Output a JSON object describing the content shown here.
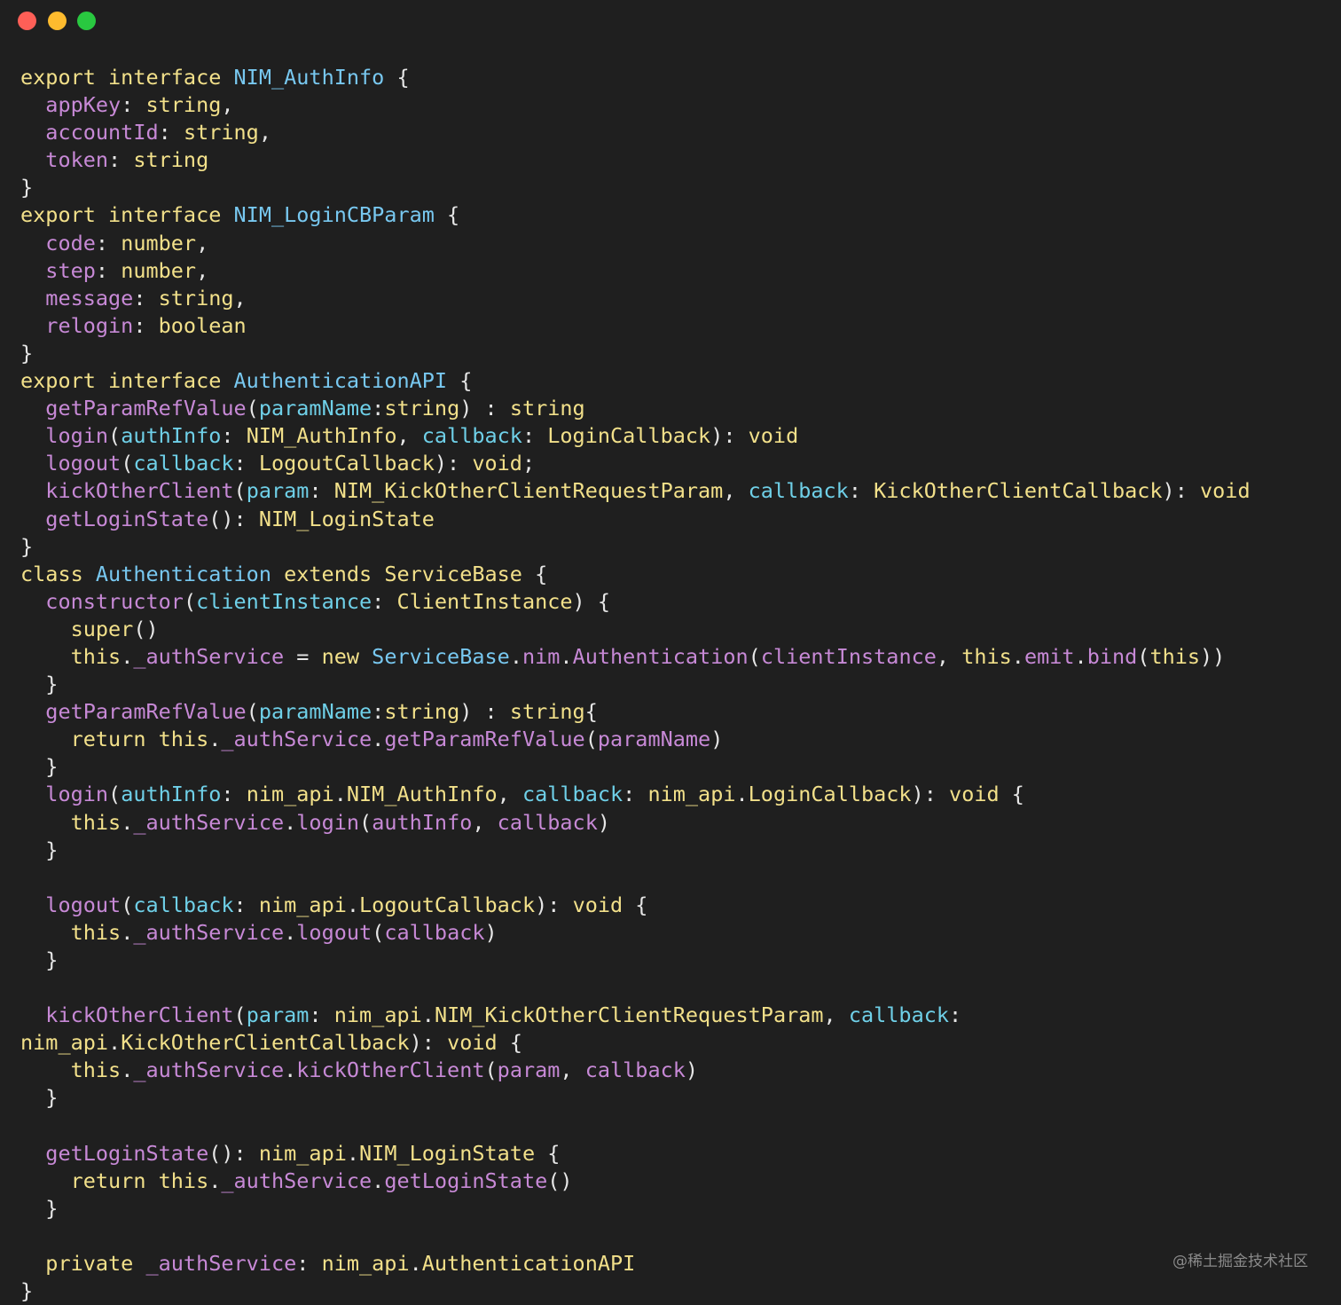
{
  "window": {
    "controls": [
      {
        "name": "close",
        "color": "#fe5f57"
      },
      {
        "name": "minimize",
        "color": "#febb2e"
      },
      {
        "name": "zoom",
        "color": "#29c840"
      }
    ]
  },
  "colors": {
    "background": "#1f1f1f",
    "keyword": "#f2e08a",
    "type": "#78c8f0",
    "property": "#c789d6",
    "parameter": "#6fd0e8",
    "plain": "#e6e6e6"
  },
  "code_lines": [
    [
      [
        "kw",
        "export interface "
      ],
      [
        "type",
        "NIM_AuthInfo"
      ],
      [
        "plain",
        " {"
      ]
    ],
    [
      [
        "plain",
        "  "
      ],
      [
        "prop",
        "appKey"
      ],
      [
        "plain",
        ": "
      ],
      [
        "kw",
        "string"
      ],
      [
        "plain",
        ","
      ]
    ],
    [
      [
        "plain",
        "  "
      ],
      [
        "prop",
        "accountId"
      ],
      [
        "plain",
        ": "
      ],
      [
        "kw",
        "string"
      ],
      [
        "plain",
        ","
      ]
    ],
    [
      [
        "plain",
        "  "
      ],
      [
        "prop",
        "token"
      ],
      [
        "plain",
        ": "
      ],
      [
        "kw",
        "string"
      ]
    ],
    [
      [
        "plain",
        "}"
      ]
    ],
    [
      [
        "kw",
        "export interface "
      ],
      [
        "type",
        "NIM_LoginCBParam"
      ],
      [
        "plain",
        " {"
      ]
    ],
    [
      [
        "plain",
        "  "
      ],
      [
        "prop",
        "code"
      ],
      [
        "plain",
        ": "
      ],
      [
        "kw",
        "number"
      ],
      [
        "plain",
        ","
      ]
    ],
    [
      [
        "plain",
        "  "
      ],
      [
        "prop",
        "step"
      ],
      [
        "plain",
        ": "
      ],
      [
        "kw",
        "number"
      ],
      [
        "plain",
        ","
      ]
    ],
    [
      [
        "plain",
        "  "
      ],
      [
        "prop",
        "message"
      ],
      [
        "plain",
        ": "
      ],
      [
        "kw",
        "string"
      ],
      [
        "plain",
        ","
      ]
    ],
    [
      [
        "plain",
        "  "
      ],
      [
        "prop",
        "relogin"
      ],
      [
        "plain",
        ": "
      ],
      [
        "kw",
        "boolean"
      ]
    ],
    [
      [
        "plain",
        "}"
      ]
    ],
    [
      [
        "kw",
        "export interface "
      ],
      [
        "type",
        "AuthenticationAPI"
      ],
      [
        "plain",
        " {"
      ]
    ],
    [
      [
        "plain",
        "  "
      ],
      [
        "fn",
        "getParamRefValue"
      ],
      [
        "plain",
        "("
      ],
      [
        "param",
        "paramName"
      ],
      [
        "plain",
        ":"
      ],
      [
        "kw",
        "string"
      ],
      [
        "plain",
        ") : "
      ],
      [
        "kw",
        "string"
      ]
    ],
    [
      [
        "plain",
        "  "
      ],
      [
        "fn",
        "login"
      ],
      [
        "plain",
        "("
      ],
      [
        "param",
        "authInfo"
      ],
      [
        "plain",
        ": "
      ],
      [
        "kw",
        "NIM_AuthInfo"
      ],
      [
        "plain",
        ", "
      ],
      [
        "param",
        "callback"
      ],
      [
        "plain",
        ": "
      ],
      [
        "kw",
        "LoginCallback"
      ],
      [
        "plain",
        "): "
      ],
      [
        "kw",
        "void"
      ]
    ],
    [
      [
        "plain",
        "  "
      ],
      [
        "fn",
        "logout"
      ],
      [
        "plain",
        "("
      ],
      [
        "param",
        "callback"
      ],
      [
        "plain",
        ": "
      ],
      [
        "kw",
        "LogoutCallback"
      ],
      [
        "plain",
        "): "
      ],
      [
        "kw",
        "void"
      ],
      [
        "plain",
        ";"
      ]
    ],
    [
      [
        "plain",
        "  "
      ],
      [
        "fn",
        "kickOtherClient"
      ],
      [
        "plain",
        "("
      ],
      [
        "param",
        "param"
      ],
      [
        "plain",
        ": "
      ],
      [
        "kw",
        "NIM_KickOtherClientRequestParam"
      ],
      [
        "plain",
        ", "
      ],
      [
        "param",
        "callback"
      ],
      [
        "plain",
        ": "
      ],
      [
        "kw",
        "KickOtherClientCallback"
      ],
      [
        "plain",
        "): "
      ],
      [
        "kw",
        "void"
      ]
    ],
    [
      [
        "plain",
        "  "
      ],
      [
        "fn",
        "getLoginState"
      ],
      [
        "plain",
        "(): "
      ],
      [
        "kw",
        "NIM_LoginState"
      ]
    ],
    [
      [
        "plain",
        "}"
      ]
    ],
    [
      [
        "kw",
        "class "
      ],
      [
        "type",
        "Authentication"
      ],
      [
        "kw",
        " extends "
      ],
      [
        "kw",
        "ServiceBase"
      ],
      [
        "plain",
        " {"
      ]
    ],
    [
      [
        "plain",
        "  "
      ],
      [
        "fn",
        "constructor"
      ],
      [
        "plain",
        "("
      ],
      [
        "param",
        "clientInstance"
      ],
      [
        "plain",
        ": "
      ],
      [
        "kw",
        "ClientInstance"
      ],
      [
        "plain",
        ") {"
      ]
    ],
    [
      [
        "plain",
        "    "
      ],
      [
        "kw",
        "super"
      ],
      [
        "plain",
        "()"
      ]
    ],
    [
      [
        "plain",
        "    "
      ],
      [
        "kw",
        "this"
      ],
      [
        "plain",
        "."
      ],
      [
        "fn",
        "_authService"
      ],
      [
        "plain",
        " = "
      ],
      [
        "kw",
        "new "
      ],
      [
        "type",
        "ServiceBase"
      ],
      [
        "plain",
        "."
      ],
      [
        "fn",
        "nim"
      ],
      [
        "plain",
        "."
      ],
      [
        "fn",
        "Authentication"
      ],
      [
        "plain",
        "("
      ],
      [
        "fn",
        "clientInstance"
      ],
      [
        "plain",
        ", "
      ],
      [
        "kw",
        "this"
      ],
      [
        "plain",
        "."
      ],
      [
        "fn",
        "emit"
      ],
      [
        "plain",
        "."
      ],
      [
        "fn",
        "bind"
      ],
      [
        "plain",
        "("
      ],
      [
        "kw",
        "this"
      ],
      [
        "plain",
        "))"
      ]
    ],
    [
      [
        "plain",
        "  }"
      ]
    ],
    [
      [
        "plain",
        "  "
      ],
      [
        "fn",
        "getParamRefValue"
      ],
      [
        "plain",
        "("
      ],
      [
        "param",
        "paramName"
      ],
      [
        "plain",
        ":"
      ],
      [
        "kw",
        "string"
      ],
      [
        "plain",
        ") : "
      ],
      [
        "kw",
        "string"
      ],
      [
        "plain",
        "{"
      ]
    ],
    [
      [
        "plain",
        "    "
      ],
      [
        "kw",
        "return this"
      ],
      [
        "plain",
        "."
      ],
      [
        "fn",
        "_authService"
      ],
      [
        "plain",
        "."
      ],
      [
        "fn",
        "getParamRefValue"
      ],
      [
        "plain",
        "("
      ],
      [
        "fn",
        "paramName"
      ],
      [
        "plain",
        ")"
      ]
    ],
    [
      [
        "plain",
        "  }"
      ]
    ],
    [
      [
        "plain",
        "  "
      ],
      [
        "fn",
        "login"
      ],
      [
        "plain",
        "("
      ],
      [
        "param",
        "authInfo"
      ],
      [
        "plain",
        ": "
      ],
      [
        "kw",
        "nim_api"
      ],
      [
        "plain",
        "."
      ],
      [
        "kw",
        "NIM_AuthInfo"
      ],
      [
        "plain",
        ", "
      ],
      [
        "param",
        "callback"
      ],
      [
        "plain",
        ": "
      ],
      [
        "kw",
        "nim_api"
      ],
      [
        "plain",
        "."
      ],
      [
        "kw",
        "LoginCallback"
      ],
      [
        "plain",
        "): "
      ],
      [
        "kw",
        "void"
      ],
      [
        "plain",
        " {"
      ]
    ],
    [
      [
        "plain",
        "    "
      ],
      [
        "kw",
        "this"
      ],
      [
        "plain",
        "."
      ],
      [
        "fn",
        "_authService"
      ],
      [
        "plain",
        "."
      ],
      [
        "fn",
        "login"
      ],
      [
        "plain",
        "("
      ],
      [
        "fn",
        "authInfo"
      ],
      [
        "plain",
        ", "
      ],
      [
        "fn",
        "callback"
      ],
      [
        "plain",
        ")"
      ]
    ],
    [
      [
        "plain",
        "  }"
      ]
    ],
    [
      [
        "plain",
        ""
      ]
    ],
    [
      [
        "plain",
        "  "
      ],
      [
        "fn",
        "logout"
      ],
      [
        "plain",
        "("
      ],
      [
        "param",
        "callback"
      ],
      [
        "plain",
        ": "
      ],
      [
        "kw",
        "nim_api"
      ],
      [
        "plain",
        "."
      ],
      [
        "kw",
        "LogoutCallback"
      ],
      [
        "plain",
        "): "
      ],
      [
        "kw",
        "void"
      ],
      [
        "plain",
        " {"
      ]
    ],
    [
      [
        "plain",
        "    "
      ],
      [
        "kw",
        "this"
      ],
      [
        "plain",
        "."
      ],
      [
        "fn",
        "_authService"
      ],
      [
        "plain",
        "."
      ],
      [
        "fn",
        "logout"
      ],
      [
        "plain",
        "("
      ],
      [
        "fn",
        "callback"
      ],
      [
        "plain",
        ")"
      ]
    ],
    [
      [
        "plain",
        "  }"
      ]
    ],
    [
      [
        "plain",
        ""
      ]
    ],
    [
      [
        "plain",
        "  "
      ],
      [
        "fn",
        "kickOtherClient"
      ],
      [
        "plain",
        "("
      ],
      [
        "param",
        "param"
      ],
      [
        "plain",
        ": "
      ],
      [
        "kw",
        "nim_api"
      ],
      [
        "plain",
        "."
      ],
      [
        "kw",
        "NIM_KickOtherClientRequestParam"
      ],
      [
        "plain",
        ", "
      ],
      [
        "param",
        "callback"
      ],
      [
        "plain",
        ":"
      ]
    ],
    [
      [
        "kw",
        "nim_api"
      ],
      [
        "plain",
        "."
      ],
      [
        "kw",
        "KickOtherClientCallback"
      ],
      [
        "plain",
        "): "
      ],
      [
        "kw",
        "void"
      ],
      [
        "plain",
        " {"
      ]
    ],
    [
      [
        "plain",
        "    "
      ],
      [
        "kw",
        "this"
      ],
      [
        "plain",
        "."
      ],
      [
        "fn",
        "_authService"
      ],
      [
        "plain",
        "."
      ],
      [
        "fn",
        "kickOtherClient"
      ],
      [
        "plain",
        "("
      ],
      [
        "fn",
        "param"
      ],
      [
        "plain",
        ", "
      ],
      [
        "fn",
        "callback"
      ],
      [
        "plain",
        ")"
      ]
    ],
    [
      [
        "plain",
        "  }"
      ]
    ],
    [
      [
        "plain",
        ""
      ]
    ],
    [
      [
        "plain",
        "  "
      ],
      [
        "fn",
        "getLoginState"
      ],
      [
        "plain",
        "(): "
      ],
      [
        "kw",
        "nim_api"
      ],
      [
        "plain",
        "."
      ],
      [
        "kw",
        "NIM_LoginState"
      ],
      [
        "plain",
        " {"
      ]
    ],
    [
      [
        "plain",
        "    "
      ],
      [
        "kw",
        "return this"
      ],
      [
        "plain",
        "."
      ],
      [
        "fn",
        "_authService"
      ],
      [
        "plain",
        "."
      ],
      [
        "fn",
        "getLoginState"
      ],
      [
        "plain",
        "()"
      ]
    ],
    [
      [
        "plain",
        "  }"
      ]
    ],
    [
      [
        "plain",
        ""
      ]
    ],
    [
      [
        "plain",
        "  "
      ],
      [
        "kw",
        "private "
      ],
      [
        "fn",
        "_authService"
      ],
      [
        "plain",
        ": "
      ],
      [
        "kw",
        "nim_api"
      ],
      [
        "plain",
        "."
      ],
      [
        "kw",
        "AuthenticationAPI"
      ]
    ],
    [
      [
        "plain",
        "}"
      ]
    ]
  ],
  "watermark": "@稀土掘金技术社区"
}
